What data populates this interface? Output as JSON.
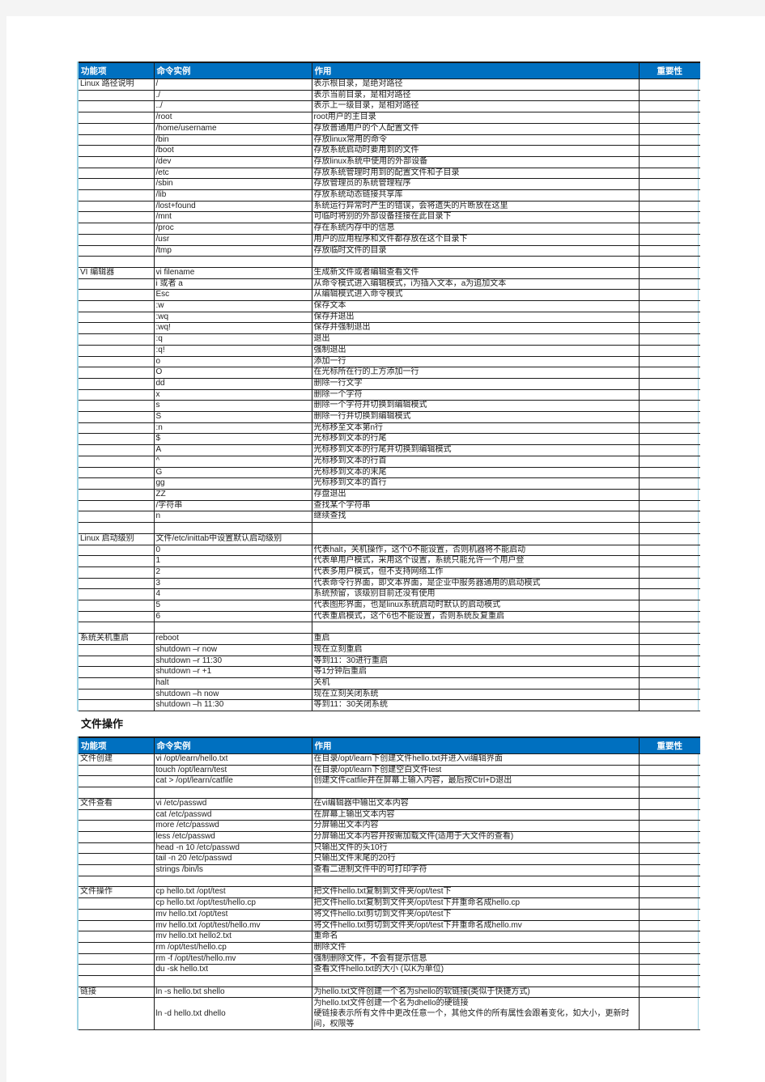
{
  "headers": {
    "feature": "功能项",
    "command": "命令实例",
    "purpose": "作用",
    "importance": "重要性"
  },
  "section2_title": "文件操作",
  "table1": [
    {
      "cat": "Linux 路径说明",
      "cmd": "/",
      "desc": "表示根目录，是绝对路径"
    },
    {
      "cat": "",
      "cmd": "./",
      "desc": "表示当前目录，是相对路径"
    },
    {
      "cat": "",
      "cmd": "../",
      "desc": "表示上一级目录，是相对路径"
    },
    {
      "cat": "",
      "cmd": "/root",
      "desc": "root用户的主目录"
    },
    {
      "cat": "",
      "cmd": "/home/username",
      "desc": "存放普通用户的个人配置文件"
    },
    {
      "cat": "",
      "cmd": "/bin",
      "desc": "存放linux常用的命令"
    },
    {
      "cat": "",
      "cmd": "/boot",
      "desc": "存放系统启动时要用到的文件"
    },
    {
      "cat": "",
      "cmd": "/dev",
      "desc": "存放linux系统中使用的外部设备"
    },
    {
      "cat": "",
      "cmd": "/etc",
      "desc": "存放系统管理时用到的配置文件和子目录"
    },
    {
      "cat": "",
      "cmd": "/sbin",
      "desc": "存放管理员的系统管理程序"
    },
    {
      "cat": "",
      "cmd": "/lib",
      "desc": "存放系统动态链接共享库"
    },
    {
      "cat": "",
      "cmd": "/lost+found",
      "desc": "系统运行异常时产生的错误，会将遗失的片断放在这里"
    },
    {
      "cat": "",
      "cmd": "/mnt",
      "desc": "可临时将别的外部设备挂接在此目录下"
    },
    {
      "cat": "",
      "cmd": "/proc",
      "desc": "存在系统内存中的信息"
    },
    {
      "cat": "",
      "cmd": "/usr",
      "desc": "用户的应用程序和文件都存放在这个目录下"
    },
    {
      "cat": "",
      "cmd": "/tmp",
      "desc": "存放临时文件的目录"
    },
    {
      "cat": "",
      "cmd": "",
      "desc": ""
    },
    {
      "cat": "VI 编辑器",
      "cmd": "vi filename",
      "desc": "生成新文件或者编辑查看文件"
    },
    {
      "cat": "",
      "cmd": "i 或者 a",
      "desc": "从命令模式进入编辑模式，i为插入文本，a为追加文本"
    },
    {
      "cat": "",
      "cmd": "Esc",
      "desc": "从编辑模式进入命令模式"
    },
    {
      "cat": "",
      "cmd": ":w",
      "desc": "保存文本"
    },
    {
      "cat": "",
      "cmd": ":wq",
      "desc": "保存并退出"
    },
    {
      "cat": "",
      "cmd": ":wq!",
      "desc": "保存并强制退出"
    },
    {
      "cat": "",
      "cmd": ":q",
      "desc": "退出"
    },
    {
      "cat": "",
      "cmd": ":q!",
      "desc": "强制退出"
    },
    {
      "cat": "",
      "cmd": "o",
      "desc": "添加一行"
    },
    {
      "cat": "",
      "cmd": "O",
      "desc": "在光标所在行的上方添加一行"
    },
    {
      "cat": "",
      "cmd": "dd",
      "desc": "删除一行文字"
    },
    {
      "cat": "",
      "cmd": "x",
      "desc": "删除一个字符"
    },
    {
      "cat": "",
      "cmd": "s",
      "desc": "删除一个字符并切换到编辑模式"
    },
    {
      "cat": "",
      "cmd": "S",
      "desc": "删除一行并切换到编辑模式"
    },
    {
      "cat": "",
      "cmd": ":n",
      "desc": "光标移至文本第n行"
    },
    {
      "cat": "",
      "cmd": "$",
      "desc": "光标移到文本的行尾"
    },
    {
      "cat": "",
      "cmd": "A",
      "desc": "光标移到文本的行尾并切换到编辑模式"
    },
    {
      "cat": "",
      "cmd": "^",
      "desc": "光标移到文本的行首"
    },
    {
      "cat": "",
      "cmd": "G",
      "desc": "光标移到文本的末尾"
    },
    {
      "cat": "",
      "cmd": "gg",
      "desc": "光标移到文本的首行"
    },
    {
      "cat": "",
      "cmd": "ZZ",
      "desc": "存盘退出"
    },
    {
      "cat": "",
      "cmd": "/字符串",
      "desc": "查找某个字符串"
    },
    {
      "cat": "",
      "cmd": "n",
      "desc": "继续查找"
    },
    {
      "cat": "",
      "cmd": "",
      "desc": ""
    },
    {
      "cat": "Linux 启动级别",
      "cmd": "文件/etc/inittab中设置默认启动级别",
      "desc": ""
    },
    {
      "cat": "",
      "cmd": "0",
      "desc": "代表halt，关机操作，这个0不能设置，否则机器将不能启动"
    },
    {
      "cat": "",
      "cmd": "1",
      "desc": "代表单用户模式，采用这个设置，系统只能允许一个用户登"
    },
    {
      "cat": "",
      "cmd": "2",
      "desc": "代表多用户模式，但不支持网络工作"
    },
    {
      "cat": "",
      "cmd": "3",
      "desc": "代表命令行界面，即文本界面，是企业中服务器通用的启动模式"
    },
    {
      "cat": "",
      "cmd": "4",
      "desc": "系统预留，该级别目前还没有使用"
    },
    {
      "cat": "",
      "cmd": "5",
      "desc": "代表图形界面，也是linux系统启动时默认的启动模式"
    },
    {
      "cat": "",
      "cmd": "6",
      "desc": "代表重启模式，这个6也不能设置，否则系统反复重启"
    },
    {
      "cat": "",
      "cmd": "",
      "desc": ""
    },
    {
      "cat": "系统关机重启",
      "cmd": "reboot",
      "desc": "重启"
    },
    {
      "cat": "",
      "cmd": "shutdown  –r  now",
      "desc": "现在立刻重启"
    },
    {
      "cat": "",
      "cmd": "shutdown  –r  11:30",
      "desc": "等到11：30进行重启"
    },
    {
      "cat": "",
      "cmd": "shutdown  –r  +1",
      "desc": "等1分钟后重启"
    },
    {
      "cat": "",
      "cmd": "halt",
      "desc": "关机"
    },
    {
      "cat": "",
      "cmd": "shutdown  –h  now",
      "desc": "现在立刻关闭系统"
    },
    {
      "cat": "",
      "cmd": "shutdown  –h 11:30",
      "desc": "等到11：30关闭系统"
    }
  ],
  "table2": [
    {
      "cat": "文件创建",
      "cmd": "vi /opt/learn/hello.txt",
      "desc": "在目录/opt/learn下创建文件hello.txt并进入vi编辑界面"
    },
    {
      "cat": "",
      "cmd": "touch /opt/learn/test",
      "desc": "在目录/opt/learn下创建空白文件test"
    },
    {
      "cat": "",
      "cmd": "cat > /opt/learn/catfile",
      "desc": "创建文件catfile并在屏幕上输入内容，最后按Ctrl+D退出"
    },
    {
      "cat": "",
      "cmd": "",
      "desc": ""
    },
    {
      "cat": "文件查看",
      "cmd": "vi /etc/passwd",
      "desc": "在vi编辑器中输出文本内容"
    },
    {
      "cat": "",
      "cmd": "cat /etc/passwd",
      "desc": "在屏幕上输出文本内容"
    },
    {
      "cat": "",
      "cmd": "more /etc/passwd",
      "desc": "分屏输出文本内容"
    },
    {
      "cat": "",
      "cmd": "less /etc/passwd",
      "desc": "分屏输出文本内容并按需加载文件(适用于大文件的查看)"
    },
    {
      "cat": "",
      "cmd": "head -n 10 /etc/passwd",
      "desc": "只输出文件的头10行"
    },
    {
      "cat": "",
      "cmd": "tail -n 20 /etc/passwd",
      "desc": "只输出文件末尾的20行"
    },
    {
      "cat": "",
      "cmd": "strings /bin/ls",
      "desc": "查看二进制文件中的可打印字符"
    },
    {
      "cat": "",
      "cmd": "",
      "desc": ""
    },
    {
      "cat": "文件操作",
      "cmd": "cp hello.txt /opt/test",
      "desc": "把文件hello.txt复制到文件夹/opt/test下"
    },
    {
      "cat": "",
      "cmd": "cp hello.txt /opt/test/hello.cp",
      "desc": "把文件hello.txt复制到文件夹/opt/test下并重命名成hello.cp"
    },
    {
      "cat": "",
      "cmd": "mv hello.txt /opt/test",
      "desc": "将文件hello.txt剪切到文件夹/opt/test下"
    },
    {
      "cat": "",
      "cmd": "mv hello.txt /opt/test/hello.mv",
      "desc": "将文件hello.txt剪切到文件夹/opt/test下并重命名成hello.mv"
    },
    {
      "cat": "",
      "cmd": "mv hello.txt hello2.txt",
      "desc": "重命名"
    },
    {
      "cat": "",
      "cmd": "rm /opt/test/hello.cp",
      "desc": "删除文件"
    },
    {
      "cat": "",
      "cmd": "rm -f /opt/test/hello.mv",
      "desc": "强制删除文件，不会有提示信息"
    },
    {
      "cat": "",
      "cmd": "du -sk hello.txt",
      "desc": "查看文件hello.txt的大小 (以K为单位)"
    },
    {
      "cat": "",
      "cmd": "",
      "desc": ""
    },
    {
      "cat": "链接",
      "cmd": "ln -s hello.txt shello",
      "desc": "为hello.txt文件创建一个名为shello的软链接(类似于快捷方式)"
    },
    {
      "cat": "",
      "cmd": "ln -d hello.txt dhello",
      "desc": "为hello.txt文件创建一个名为dhello的硬链接\n硬链接表示所有文件中更改任意一个，其他文件的所有属性会跟着变化，如大小，更新时间，权限等",
      "multiline": true
    }
  ]
}
